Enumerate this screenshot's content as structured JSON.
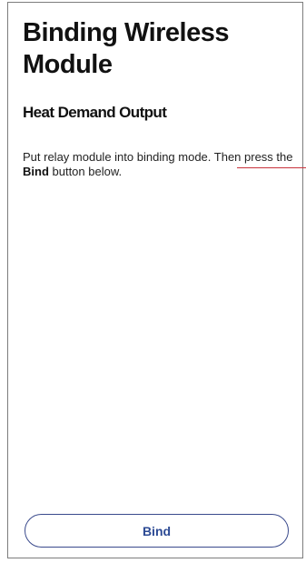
{
  "screen": {
    "title": "Binding Wireless Module",
    "subtitle": "Heat Demand Output",
    "instruction": {
      "text_before": "Put relay module into binding mode. Then press the ",
      "bold_word": "Bind",
      "text_after": " button below."
    }
  },
  "actions": {
    "bind_label": "Bind"
  },
  "colors": {
    "button_border": "#3a4a8c",
    "button_text": "#2c4a94",
    "annotation_line": "#c8323c"
  }
}
